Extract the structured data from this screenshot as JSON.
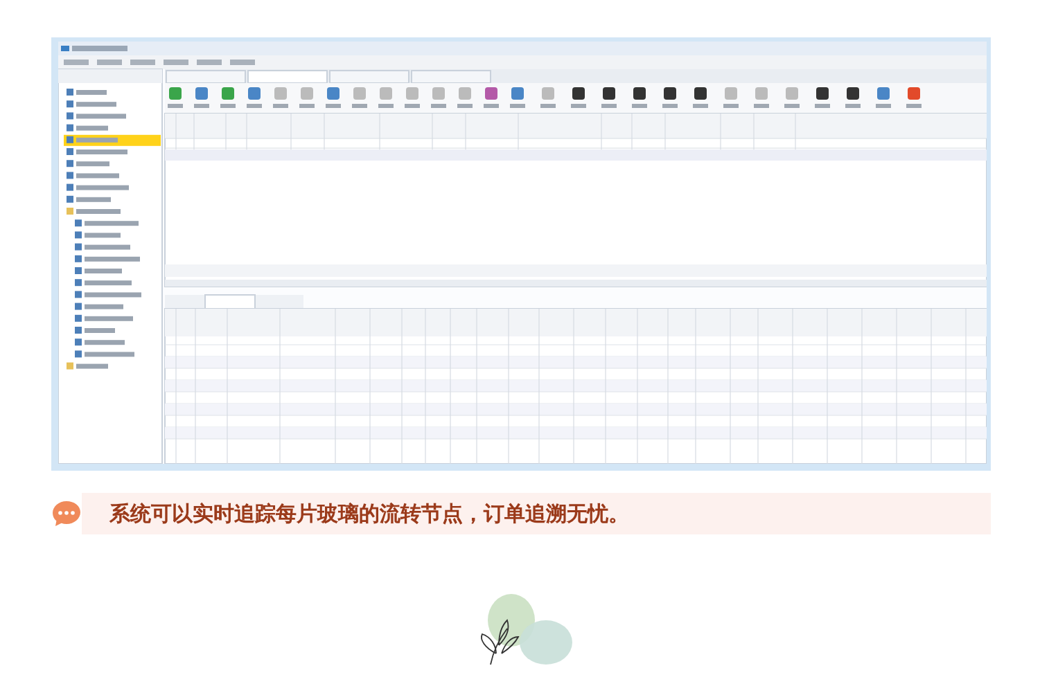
{
  "figure": {
    "kind": "screenshot"
  },
  "caption": {
    "text": "系统可以实时追踪每片玻璃的流转节点，订单追溯无忧。"
  },
  "decoration": {
    "kind": "plant"
  }
}
